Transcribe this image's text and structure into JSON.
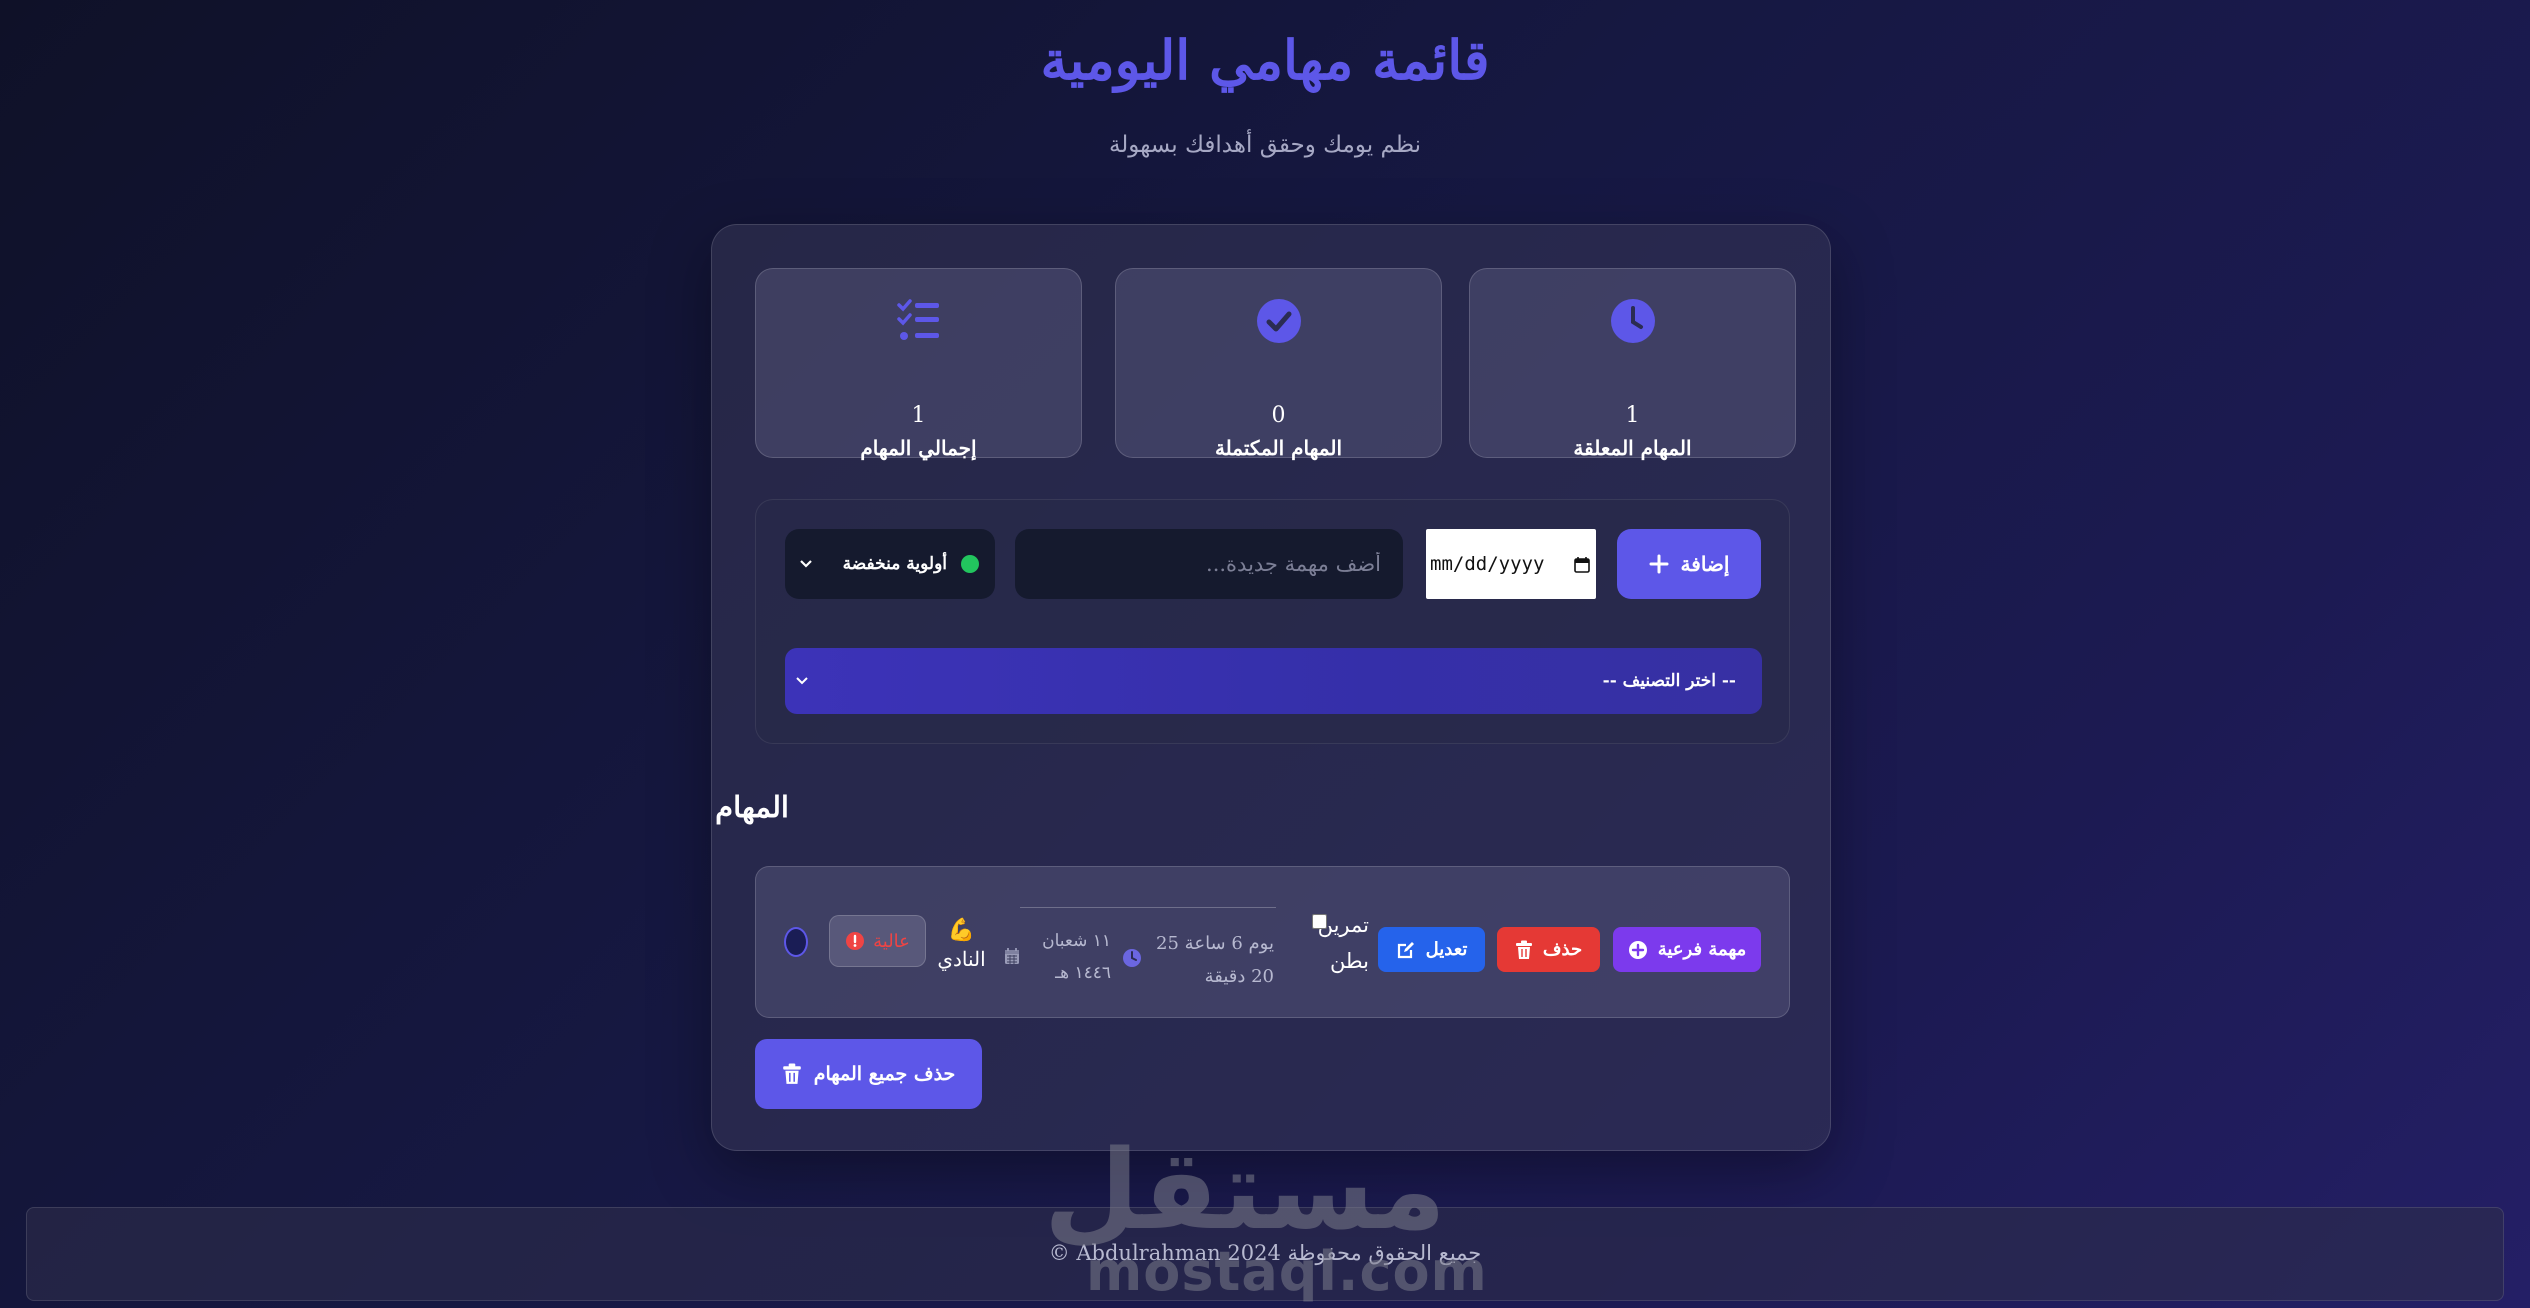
{
  "header": {
    "title": "قائمة مهامي اليومية",
    "subtitle": "نظم يومك وحقق أهدافك بسهولة"
  },
  "stats": [
    {
      "value": "1",
      "label": "المهام المعلقة",
      "icon": "clock-icon"
    },
    {
      "value": "0",
      "label": "المهام المكتملة",
      "icon": "check-circle-icon"
    },
    {
      "value": "1",
      "label": "إجمالي المهام",
      "icon": "tasks-list-icon"
    }
  ],
  "form": {
    "add_label": "إضافة",
    "date_placeholder": "mm/dd/yyyy",
    "task_placeholder": "أضف مهمة جديدة...",
    "priority_selected": "أولوية منخفضة",
    "category_selected": "-- اختر التصنيف --"
  },
  "tasks_section": {
    "title": "المهام",
    "tasks": [
      {
        "name": "تمرين بطن",
        "time": "يوم 6 ساعة 25 20 دقيقة",
        "date": "١١ شعبان ١٤٤٦ هـ",
        "place_emoji": "💪",
        "place": "النادي",
        "priority": "عالية",
        "sub_task_label": "مهمة فرعية",
        "delete_label": "حذف",
        "edit_label": "تعديل"
      }
    ]
  },
  "clear_all_label": "حذف جميع المهام",
  "footer": {
    "text": "جميع الحقوق محفوظة Abdulrahman 2024 ©"
  },
  "watermark": {
    "arabic": "مستقل",
    "latin": "mostaql.com"
  },
  "colors": {
    "accent": "#5d57e8",
    "priority_low": "#22c55e",
    "priority_high": "#ef4444",
    "edit": "#2563eb",
    "delete": "#e53935",
    "subtask": "#7c3aed"
  }
}
